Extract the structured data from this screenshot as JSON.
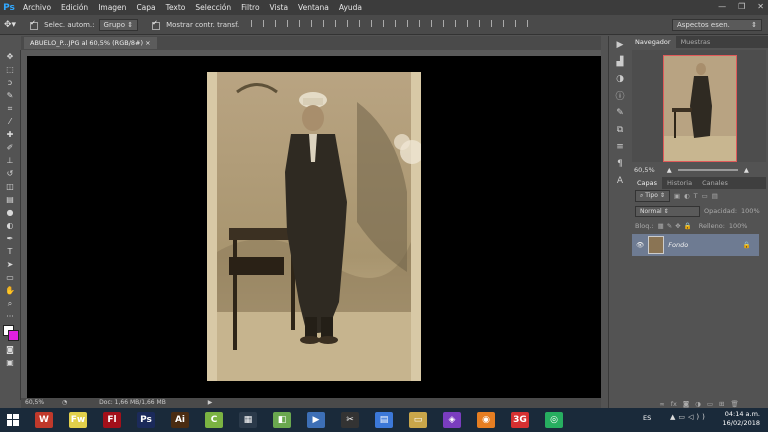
{
  "app": {
    "logo": "Ps"
  },
  "menu": [
    "Archivo",
    "Edición",
    "Imagen",
    "Capa",
    "Texto",
    "Selección",
    "Filtro",
    "Vista",
    "Ventana",
    "Ayuda"
  ],
  "window_controls": [
    "—",
    "❐",
    "✕"
  ],
  "options": {
    "autoselect_label": "Selec. autom.:",
    "autoselect_value": "Grupo",
    "transform_label": "Mostrar contr. transf.",
    "workspace": "Aspectos esen."
  },
  "document": {
    "tab_label": "ABUELO_P...JPG al 60,5% (RGB/8#)",
    "zoom": "60,5%",
    "status": "Doc: 1,66 MB/1,66 MB"
  },
  "panels": {
    "navigator_tabs": [
      "Navegador",
      "Muestras"
    ],
    "navigator_zoom": "60,5%",
    "layers_tabs": [
      "Capas",
      "Historia",
      "Canales"
    ],
    "filter_label": "Tipo",
    "blend_mode": "Normal",
    "opacity_label": "Opacidad:",
    "opacity_value": "100%",
    "lock_label": "Bloq.:",
    "fill_label": "Relleno:",
    "fill_value": "100%",
    "layer_name": "Fondo"
  },
  "taskbar": {
    "apps": [
      {
        "icon": "W",
        "color": "#c0392b"
      },
      {
        "icon": "Fw",
        "color": "#e2d04b"
      },
      {
        "icon": "Fl",
        "color": "#a3101a"
      },
      {
        "icon": "Ps",
        "color": "#1b2a5a"
      },
      {
        "icon": "Ai",
        "color": "#4a2c12"
      },
      {
        "icon": "C",
        "color": "#7bb342"
      },
      {
        "icon": "▦",
        "color": "#2b3a4a"
      },
      {
        "icon": "◧",
        "color": "#6aa84f"
      },
      {
        "icon": "▶",
        "color": "#3d6fb6"
      },
      {
        "icon": "✂",
        "color": "#333333"
      },
      {
        "icon": "▤",
        "color": "#3c78d8"
      },
      {
        "icon": "▭",
        "color": "#c9a64a"
      },
      {
        "icon": "◈",
        "color": "#7a3dbf"
      },
      {
        "icon": "◉",
        "color": "#e67e22"
      },
      {
        "icon": "3G",
        "color": "#d63031"
      },
      {
        "icon": "◎",
        "color": "#27ae60"
      }
    ],
    "language": "ES",
    "time": "04:14 a.m.",
    "date": "16/02/2018"
  }
}
